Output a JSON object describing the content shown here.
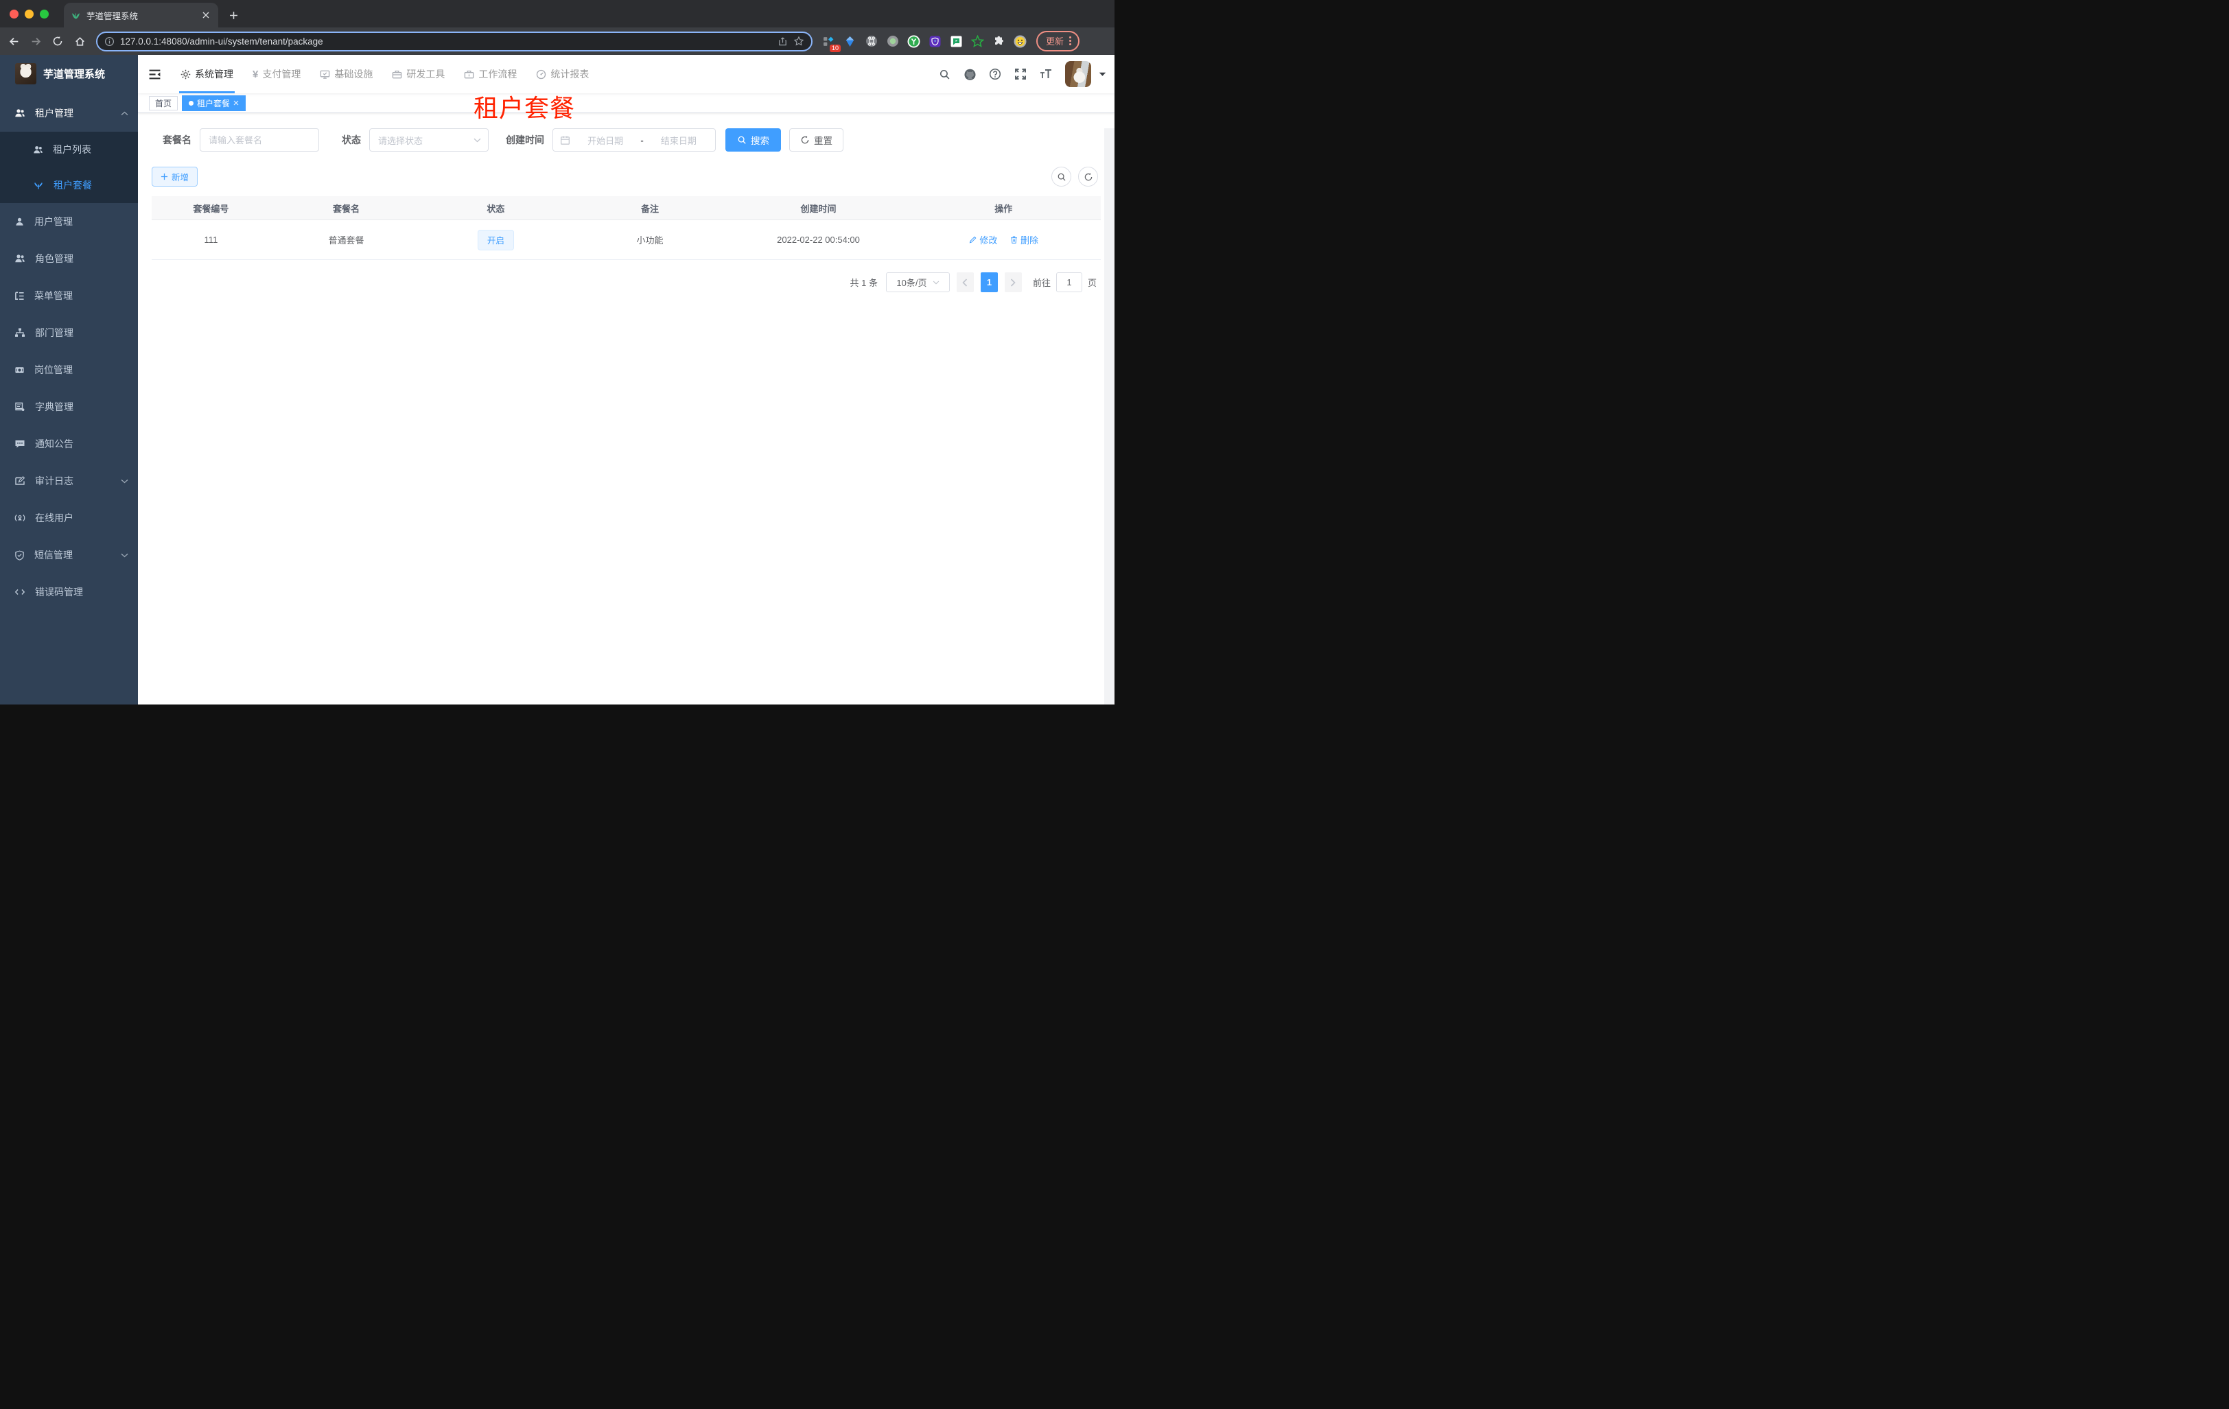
{
  "browser": {
    "tab_title": "芋道管理系统",
    "url": "127.0.0.1:48080/admin-ui/system/tenant/package",
    "ext_badge": "10",
    "update_label": "更新"
  },
  "app": {
    "colors": {
      "accent": "#409eff",
      "sidebar_bg": "#304156",
      "submenu_bg": "#1f2d3d",
      "overlay_red": "#ff2200"
    },
    "sidebar": {
      "title": "芋道管理系统",
      "items": [
        {
          "label": "租户管理"
        },
        {
          "label": "租户列表"
        },
        {
          "label": "租户套餐"
        },
        {
          "label": "用户管理"
        },
        {
          "label": "角色管理"
        },
        {
          "label": "菜单管理"
        },
        {
          "label": "部门管理"
        },
        {
          "label": "岗位管理"
        },
        {
          "label": "字典管理"
        },
        {
          "label": "通知公告"
        },
        {
          "label": "审计日志"
        },
        {
          "label": "在线用户"
        },
        {
          "label": "短信管理"
        },
        {
          "label": "错误码管理"
        }
      ]
    },
    "nav": [
      {
        "label": "系统管理"
      },
      {
        "label": "支付管理"
      },
      {
        "label": "基础设施"
      },
      {
        "label": "研发工具"
      },
      {
        "label": "工作流程"
      },
      {
        "label": "统计报表"
      }
    ],
    "tags": [
      {
        "label": "首页"
      },
      {
        "label": "租户套餐"
      }
    ],
    "overlay_title": "租户套餐",
    "filter": {
      "name_label": "套餐名",
      "name_placeholder": "请输入套餐名",
      "status_label": "状态",
      "status_placeholder": "请选择状态",
      "date_label": "创建时间",
      "date_start": "开始日期",
      "date_sep": "-",
      "date_end": "结束日期",
      "search_label": "搜索",
      "reset_label": "重置"
    },
    "toolbar": {
      "add_label": "新增"
    },
    "table": {
      "headers": [
        "套餐编号",
        "套餐名",
        "状态",
        "备注",
        "创建时间",
        "操作"
      ],
      "rows": [
        {
          "id": "111",
          "name": "普通套餐",
          "status": "开启",
          "remark": "小功能",
          "created": "2022-02-22 00:54:00",
          "edit_label": "修改",
          "delete_label": "删除"
        }
      ]
    },
    "pagination": {
      "total": "共 1 条",
      "size": "10条/页",
      "page": "1",
      "goto_label": "前往",
      "goto_value": "1",
      "unit": "页"
    }
  }
}
